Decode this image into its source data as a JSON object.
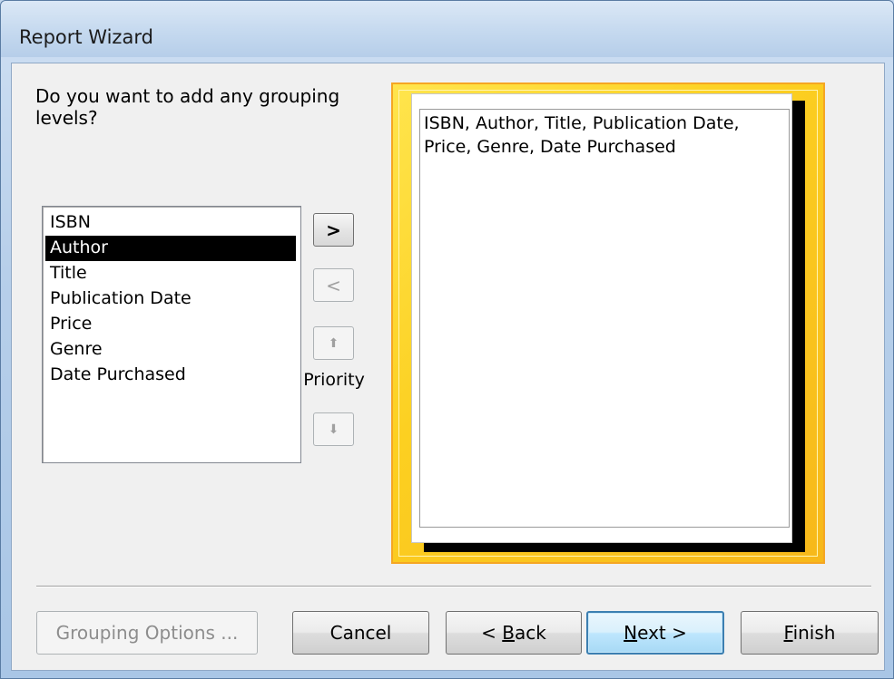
{
  "window": {
    "title": "Report Wizard"
  },
  "question": "Do you want to add any grouping levels?",
  "fields": {
    "items": [
      "ISBN",
      "Author",
      "Title",
      "Publication Date",
      "Price",
      "Genre",
      "Date Purchased"
    ],
    "selected": "Author"
  },
  "arrows": {
    "add": ">",
    "remove": "<",
    "up": "⬆",
    "down": "⬇",
    "priority_label": "Priority"
  },
  "preview": {
    "text": "ISBN, Author, Title, Publication Date, Price, Genre, Date Purchased"
  },
  "buttons": {
    "grouping_options": "Grouping Options ...",
    "cancel": "Cancel",
    "back_prefix": "< ",
    "back_underlined": "B",
    "back_rest": "ack",
    "next_underlined": "N",
    "next_rest": "ext >",
    "finish_underlined": "F",
    "finish_rest": "inish"
  },
  "colors": {
    "selection": "#000000",
    "preview_border": "#f5a623",
    "preview_fill": "#fcd021"
  }
}
